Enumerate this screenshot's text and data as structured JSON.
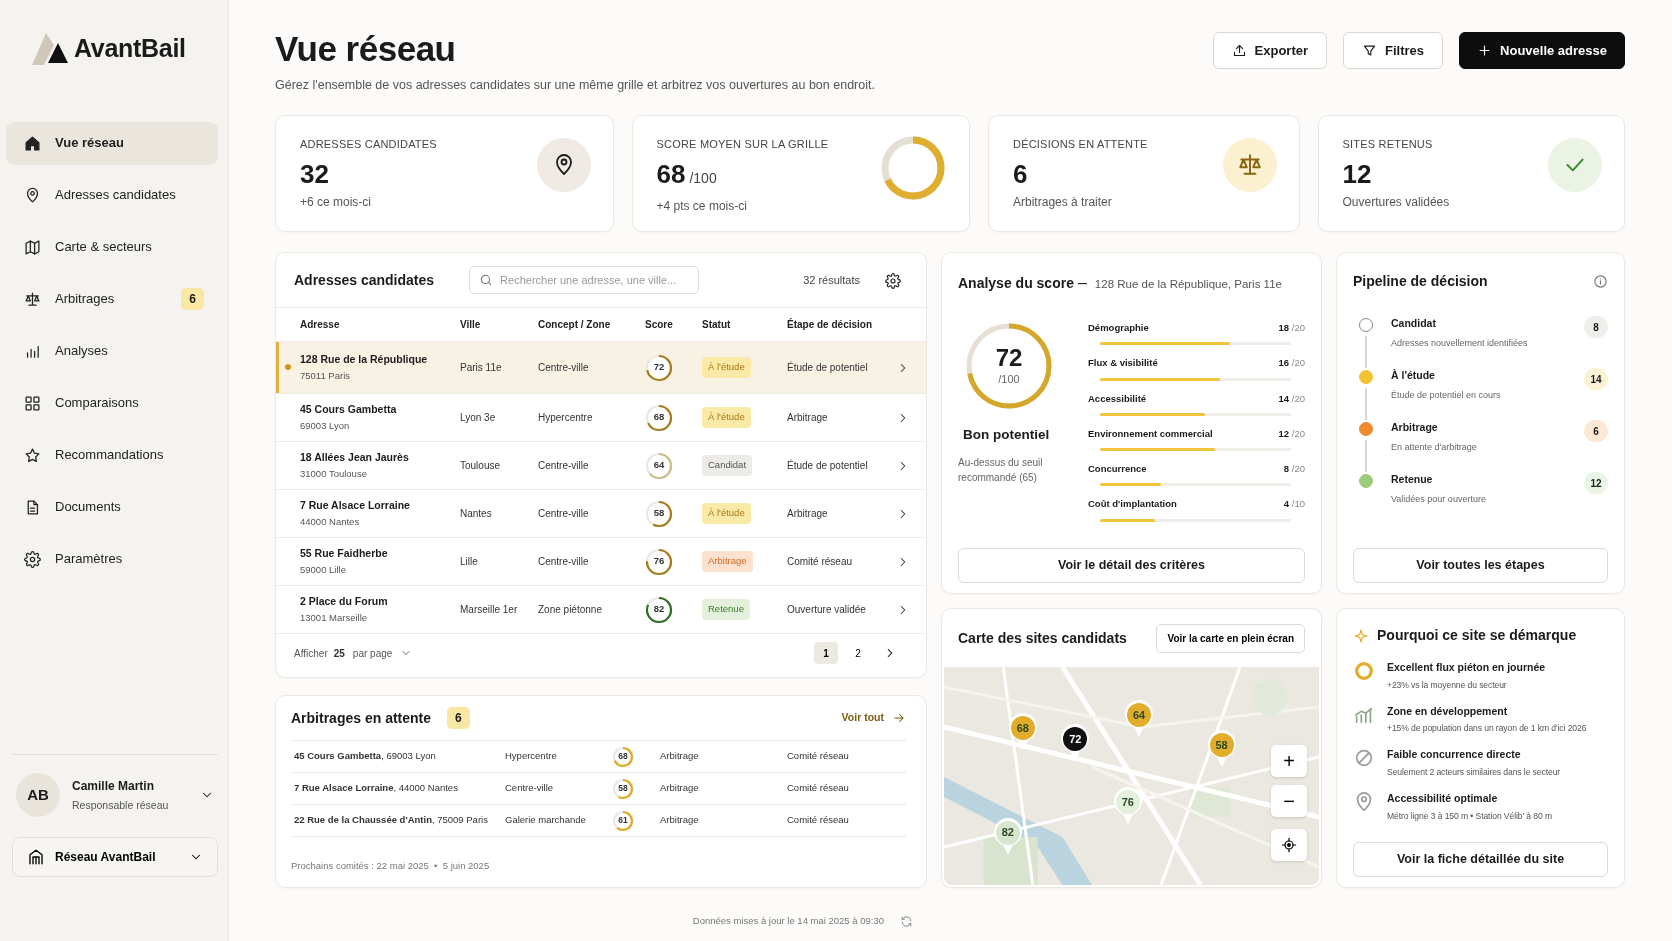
{
  "sidebar": {
    "logo": "AvantBail",
    "items": [
      {
        "label": "Vue réseau",
        "selected": true
      },
      {
        "label": "Adresses candidates",
        "selected": false
      },
      {
        "label": "Carte & secteurs",
        "selected": false
      },
      {
        "label": "Arbitrages",
        "selected": false,
        "badge": "6"
      },
      {
        "label": "Analyses",
        "selected": false
      },
      {
        "label": "Comparaisons",
        "selected": false
      },
      {
        "label": "Recommandations",
        "selected": false
      },
      {
        "label": "Documents",
        "selected": false
      },
      {
        "label": "Paramètres",
        "selected": false
      }
    ],
    "user": {
      "initials": "AB",
      "name": "Camille Martin",
      "role": "Responsable réseau"
    },
    "workspace": "Réseau AvantBail"
  },
  "header": {
    "title": "Vue réseau",
    "subtitle": "Gérez l'ensemble de vos adresses candidates sur une même grille et arbitrez vos ouvertures au bon endroit.",
    "buttons": [
      {
        "label": "Exporter",
        "kind": "outline"
      },
      {
        "label": "Filtres",
        "kind": "outline"
      },
      {
        "label": "Nouvelle adresse",
        "kind": "primary"
      }
    ]
  },
  "kpis": [
    {
      "label": "ADRESSES CANDIDATES",
      "value": "32",
      "note": "+6 ce mois-ci",
      "kind": "pin"
    },
    {
      "label": "SCORE MOYEN SUR LA GRILLE",
      "value": "68",
      "unit": "/100",
      "note": "+4 pts ce mois-ci",
      "kind": "donut"
    },
    {
      "label": "DÉCISIONS EN ATTENTE",
      "value": "6",
      "note": "Arbitrages à traiter",
      "kind": "scale"
    },
    {
      "label": "SITES RETENUS",
      "value": "12",
      "note": "Ouvertures validées",
      "kind": "check"
    }
  ],
  "table": {
    "title": "Adresses candidates",
    "search_placeholder": "Rechercher une adresse, une ville...",
    "results": "32 résultats",
    "columns": [
      "Adresse",
      "Ville",
      "Concept / Zone",
      "Score",
      "Statut",
      "Étape de décision"
    ],
    "rows": [
      {
        "address": "128 Rue de la République",
        "postcode": "75011 Paris",
        "city": "Paris 11e",
        "concept": "Centre-ville",
        "score": "72",
        "status": "À l'étude",
        "kind": "etude",
        "stage": "Étude de potentiel",
        "selected": true
      },
      {
        "address": "45 Cours Gambetta",
        "postcode": "69003 Lyon",
        "city": "Lyon 3e",
        "concept": "Hypercentre",
        "score": "68",
        "status": "À l'étude",
        "kind": "etude",
        "stage": "Arbitrage",
        "selected": false
      },
      {
        "address": "18 Allées Jean Jaurès",
        "postcode": "31000 Toulouse",
        "city": "Toulouse",
        "concept": "Centre-ville",
        "score": "64",
        "status": "Candidat",
        "kind": "candidat",
        "stage": "Étude de potentiel",
        "selected": false
      },
      {
        "address": "7 Rue Alsace Lorraine",
        "postcode": "44000 Nantes",
        "city": "Nantes",
        "concept": "Centre-ville",
        "score": "58",
        "status": "À l'étude",
        "kind": "etude",
        "stage": "Arbitrage",
        "selected": false
      },
      {
        "address": "55 Rue Faidherbe",
        "postcode": "59000 Lille",
        "city": "Lille",
        "concept": "Centre-ville",
        "score": "76",
        "status": "Arbitrage",
        "kind": "arbitrage",
        "stage": "Comité réseau",
        "selected": false
      },
      {
        "address": "2 Place du Forum",
        "postcode": "13001 Marseille",
        "city": "Marseille 1er",
        "concept": "Zone piétonne",
        "score": "82",
        "status": "Retenue",
        "kind": "retenue",
        "stage": "Ouverture validée",
        "selected": false
      }
    ],
    "per_page_label": "Afficher",
    "per_page": "25",
    "per_page_suffix": "par page",
    "pages": [
      {
        "label": "1",
        "selected": true
      },
      {
        "label": "2",
        "selected": false
      }
    ]
  },
  "pending": {
    "title": "Arbitrages en attente",
    "count": "6",
    "link": "Voir tout",
    "rows": [
      {
        "address": "**45 Cours Gambetta**, 69003 Lyon",
        "concept": "Hypercentre",
        "score": "68",
        "stage": "Arbitrage",
        "committee": "Comité réseau"
      },
      {
        "address": "**7 Rue Alsace Lorraine**, 44000 Nantes",
        "concept": "Centre-ville",
        "score": "58",
        "stage": "Arbitrage",
        "committee": "Comité réseau"
      },
      {
        "address": "**22 Rue de la Chaussée d'Antin**, 75009 Paris",
        "concept": "Galerie marchande",
        "score": "61",
        "stage": "Arbitrage",
        "committee": "Comité réseau"
      }
    ],
    "dates": "Prochains comités : 22 mai 2025  •  5 juin 2025"
  },
  "score": {
    "title": "Analyse du score",
    "separator": "–",
    "subtitle": "128 Rue de la République, Paris 11e",
    "value": "72",
    "max": "/100",
    "verdict": "Bon potentiel",
    "note": "Au-dessus du seuil recommandé (65)",
    "criteria": [
      {
        "name": "Démographie",
        "value": "18",
        "max": "/20",
        "level": 0.68
      },
      {
        "name": "Flux & visibilité",
        "value": "16",
        "max": "/20",
        "level": 0.63
      },
      {
        "name": "Accessibilité",
        "value": "14",
        "max": "/20",
        "level": 0.55
      },
      {
        "name": "Environnement commercial",
        "value": "12",
        "max": "/20",
        "level": 0.6
      },
      {
        "name": "Concurrence",
        "value": "8",
        "max": "/20",
        "level": 0.32
      },
      {
        "name": "Coût d'implantation",
        "value": "4",
        "max": "/10",
        "level": 0.29
      }
    ],
    "button": "Voir le détail des critères"
  },
  "pipeline": {
    "title": "Pipeline de décision",
    "steps": [
      {
        "name": "Candidat",
        "desc": "Adresses nouvellement identifiées",
        "count": "8",
        "color": "#ffffff"
      },
      {
        "name": "À l'étude",
        "desc": "Étude de potentiel en cours",
        "count": "14",
        "color": "#f2c230"
      },
      {
        "name": "Arbitrage",
        "desc": "En attente d'arbitrage",
        "count": "6",
        "color": "#ee8a2c"
      },
      {
        "name": "Retenue",
        "desc": "Validées pour ouverture",
        "count": "12",
        "color": "#9ccb7c"
      }
    ],
    "button": "Voir toutes les étapes"
  },
  "map": {
    "title": "Carte des sites candidats",
    "button": "Voir la carte en plein écran",
    "pins": [
      {
        "label": "68",
        "color": "#e2ad2a"
      },
      {
        "label": "72",
        "color": "#111111"
      },
      {
        "label": "64",
        "color": "#e2ad2a"
      },
      {
        "label": "58",
        "color": "#e2ad2a"
      },
      {
        "label": "76",
        "color": "#e4efdc"
      },
      {
        "label": "82",
        "color": "#d6e6cf"
      }
    ],
    "controls": [
      "+",
      "−"
    ]
  },
  "reasons": {
    "title": "Pourquoi ce site se démarque",
    "items": [
      {
        "title": "Excellent flux piéton en journée",
        "desc": "+23% vs la moyenne du secteur"
      },
      {
        "title": "Zone en développement",
        "desc": "+15% de population dans un rayon de 1 km d'ici 2026"
      },
      {
        "title": "Faible concurrence directe",
        "desc": "Seulement 2 acteurs similaires dans le secteur"
      },
      {
        "title": "Accessibilité optimale",
        "desc": "Métro ligne 3 à 150 m • Station Vélib' à 80 m"
      }
    ],
    "button": "Voir la fiche détaillée du site"
  },
  "footer": "Données mises à jour le 14 mai 2025 à 09:30"
}
